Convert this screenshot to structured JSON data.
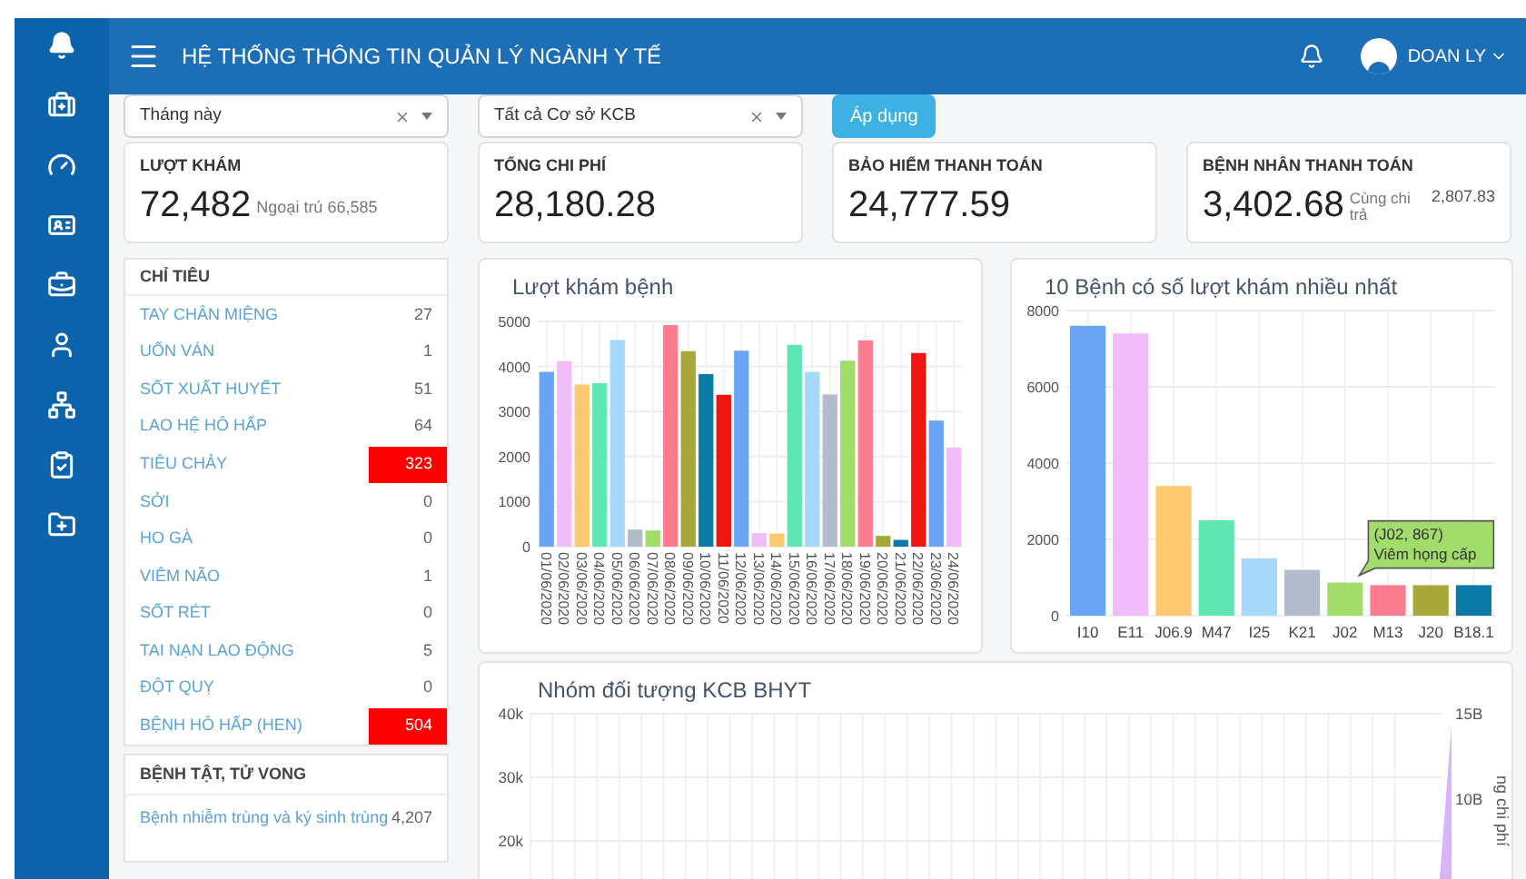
{
  "header": {
    "title": "HỆ THỐNG THÔNG TIN QUẢN LÝ NGÀNH Y TẾ",
    "user": "DOAN LY"
  },
  "filters": [
    {
      "value": "Tháng này"
    },
    {
      "value": "Tất cả Cơ sở KCB"
    }
  ],
  "apply_button": "Áp dụng",
  "kpis": [
    {
      "label": "LƯỢT KHÁM",
      "value": "72,482",
      "note": "Ngoại trú 66,585"
    },
    {
      "label": "TỔNG CHI PHÍ",
      "value": "28,180.28"
    },
    {
      "label": "BẢO HIỂM THANH TOÁN",
      "value": "24,777.59"
    },
    {
      "label": "BỆNH NHÂN THANH TOÁN",
      "value": "3,402.68",
      "note": "Cùng chi trả",
      "extra": "2,807.83"
    }
  ],
  "indicators": {
    "title": "CHỈ TIÊU",
    "items": [
      {
        "label": "TAY CHÂN MIỆNG",
        "value": "27",
        "alert": false
      },
      {
        "label": "UỐN VÁN",
        "value": "1",
        "alert": false
      },
      {
        "label": "SỐT XUẤT HUYẾT",
        "value": "51",
        "alert": false
      },
      {
        "label": "LAO HỆ HÔ HẤP",
        "value": "64",
        "alert": false
      },
      {
        "label": "TIÊU CHẢY",
        "value": "323",
        "alert": true
      },
      {
        "label": "SỞI",
        "value": "0",
        "alert": false
      },
      {
        "label": "HO GÀ",
        "value": "0",
        "alert": false
      },
      {
        "label": "VIÊM NÃO",
        "value": "1",
        "alert": false
      },
      {
        "label": "SỐT RÉT",
        "value": "0",
        "alert": false
      },
      {
        "label": "TAI NẠN LAO ĐỘNG",
        "value": "5",
        "alert": false
      },
      {
        "label": "ĐỘT QUỴ",
        "value": "0",
        "alert": false
      },
      {
        "label": "BỆNH HÔ HẤP (HEN)",
        "value": "504",
        "alert": true
      }
    ]
  },
  "diseases": {
    "title": "BỆNH TẬT, TỬ VONG",
    "items": [
      {
        "label": "Bệnh nhiễm trùng và ký sinh trùng",
        "value": "4,207"
      }
    ]
  },
  "visits_chart": {
    "chart_data": {
      "type": "bar",
      "title": "Lượt khám bệnh",
      "categories": [
        "01/06/2020",
        "02/06/2020",
        "03/06/2020",
        "04/06/2020",
        "05/06/2020",
        "06/06/2020",
        "07/06/2020",
        "08/06/2020",
        "09/06/2020",
        "10/06/2020",
        "11/06/2020",
        "12/06/2020",
        "13/06/2020",
        "14/06/2020",
        "15/06/2020",
        "16/06/2020",
        "17/06/2020",
        "18/06/2020",
        "19/06/2020",
        "20/06/2020",
        "21/06/2020",
        "22/06/2020",
        "23/06/2020",
        "24/06/2020"
      ],
      "series": [
        {
          "values": [
            3880,
            4120,
            3600,
            3630,
            4590,
            380,
            360,
            4920,
            4340,
            3830,
            3370,
            4350,
            300,
            290,
            4480,
            3880,
            3380,
            4130,
            4580,
            240,
            150,
            4300,
            2800,
            2200
          ]
        }
      ],
      "colors": [
        "#6aa5f5",
        "#f0bcfa",
        "#fec86f",
        "#5ee6b3",
        "#a6d8fa",
        "#b2bccb",
        "#a2dc6b",
        "#fb7c8e",
        "#a8a83a",
        "#0c7aa8",
        "#f0160f",
        "#6aa5f5",
        "#f0bcfa",
        "#fec86f",
        "#5ee6b3",
        "#a6d8fa",
        "#b2bccb",
        "#a2dc6b",
        "#fb7c8e",
        "#a8a83a",
        "#0c7aa8",
        "#f0160f",
        "#6aa5f5",
        "#f0bcfa"
      ],
      "ylim": [
        0,
        5000
      ],
      "yticks": [
        0,
        1000,
        2000,
        3000,
        4000,
        5000
      ],
      "grid": true
    }
  },
  "top_chart": {
    "chart_data": {
      "type": "bar",
      "title": "10 Bệnh có số lượt khám nhiều nhất",
      "categories": [
        "I10",
        "E11",
        "J06.9",
        "M47",
        "I25",
        "K21",
        "J02",
        "M13",
        "J20",
        "B18.1"
      ],
      "series": [
        {
          "values": [
            7600,
            7400,
            3400,
            2500,
            1500,
            1200,
            867,
            800,
            800,
            800
          ]
        }
      ],
      "colors": [
        "#6aa5f5",
        "#f0bcfa",
        "#fec86f",
        "#5ee6b3",
        "#a6d8fa",
        "#b2bccb",
        "#a2dc6b",
        "#fb7c8e",
        "#a8a83a",
        "#0c7aa8"
      ],
      "ylim": [
        0,
        8000
      ],
      "yticks": [
        0,
        2000,
        4000,
        6000,
        8000
      ],
      "grid": true
    },
    "tooltip": {
      "lines": [
        "(J02, 867)",
        "Viêm họng cấp"
      ]
    }
  },
  "group_chart": {
    "title": "Nhóm đối tượng KCB BHYT",
    "yticks": [
      "40k",
      "30k",
      "20k"
    ],
    "right_ticks": [
      "15B",
      "10B"
    ],
    "right_label": "ng chi phí"
  }
}
